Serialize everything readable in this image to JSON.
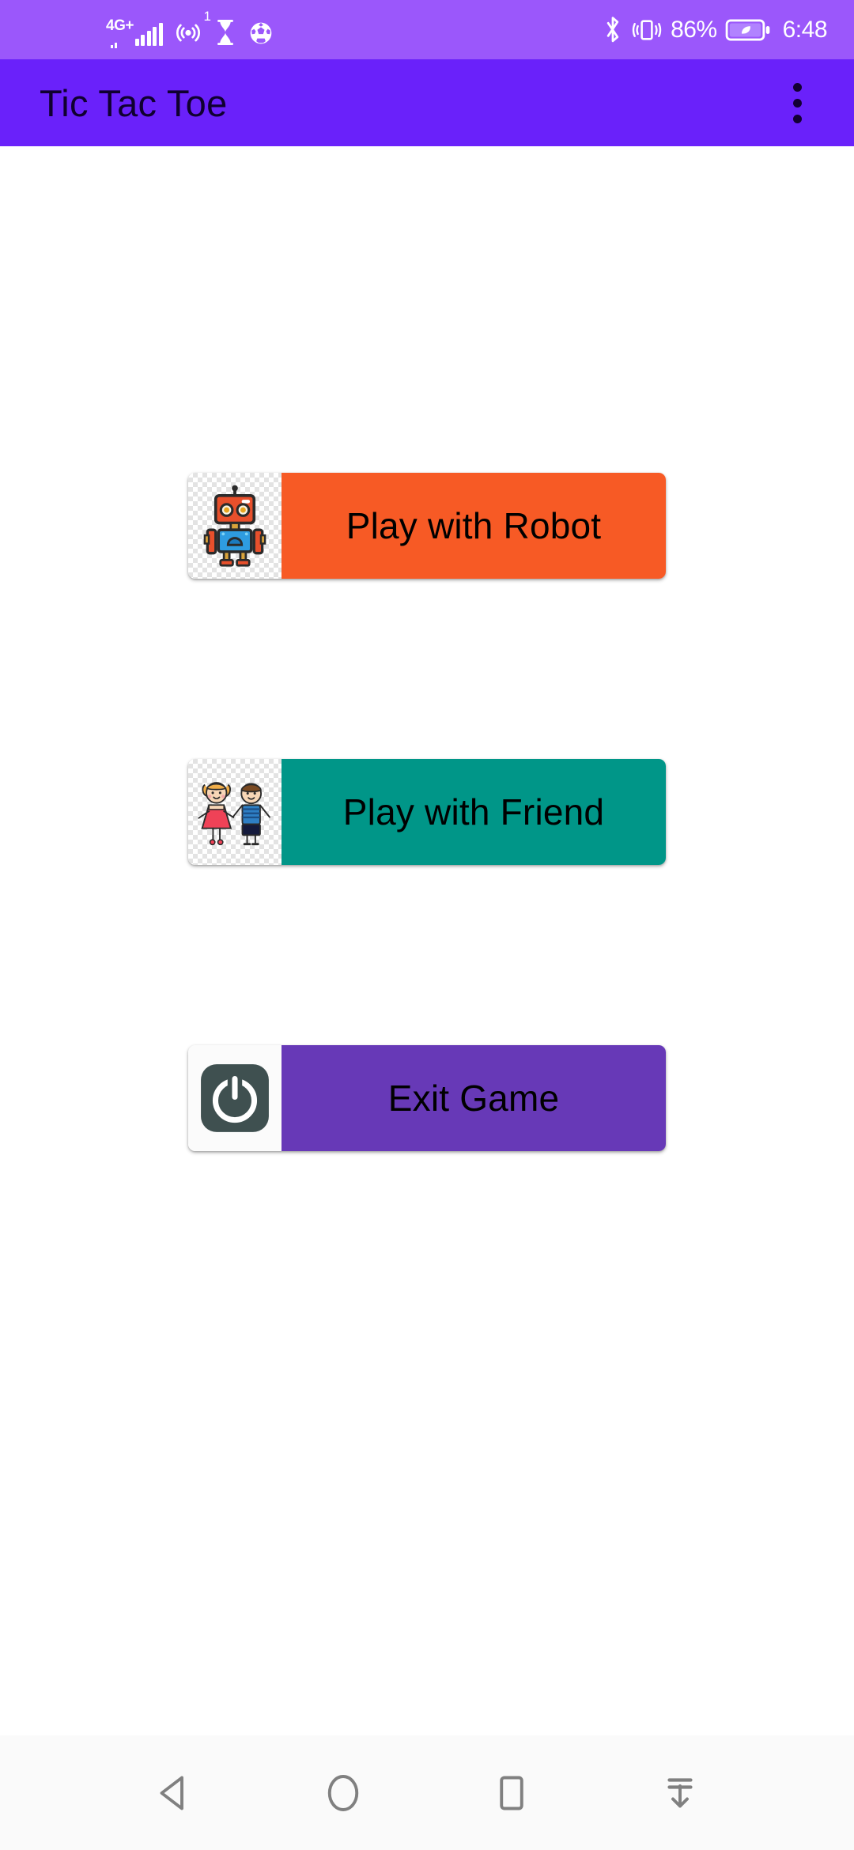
{
  "status_bar": {
    "network_label": "4G+",
    "hotspot_badge": "1",
    "battery_percent": "86%",
    "clock": "6:48",
    "icons": [
      "signal-bars-icon",
      "hotspot-icon",
      "hourglass-icon",
      "soccer-ball-icon",
      "bluetooth-icon",
      "vibrate-icon",
      "battery-eco-icon"
    ],
    "background_color": "#9b57fb"
  },
  "app_bar": {
    "title": "Tic Tac Toe",
    "overflow_menu": "overflow-menu-icon",
    "background_color": "#6a21fa",
    "title_color": "#100030"
  },
  "main": {
    "buttons": [
      {
        "label": "Play with Robot",
        "icon": "robot-icon",
        "color": "#f75a25"
      },
      {
        "label": "Play with Friend",
        "icon": "two-kids-icon",
        "color": "#009688"
      },
      {
        "label": "Exit Game",
        "icon": "power-icon",
        "color": "#6739b7"
      }
    ]
  },
  "nav_bar": {
    "back": "back-triangle-icon",
    "home": "home-circle-icon",
    "recents": "recents-square-icon",
    "pulldown": "pulldown-notification-icon",
    "background_color": "#fafafa",
    "icon_color": "#808080"
  }
}
